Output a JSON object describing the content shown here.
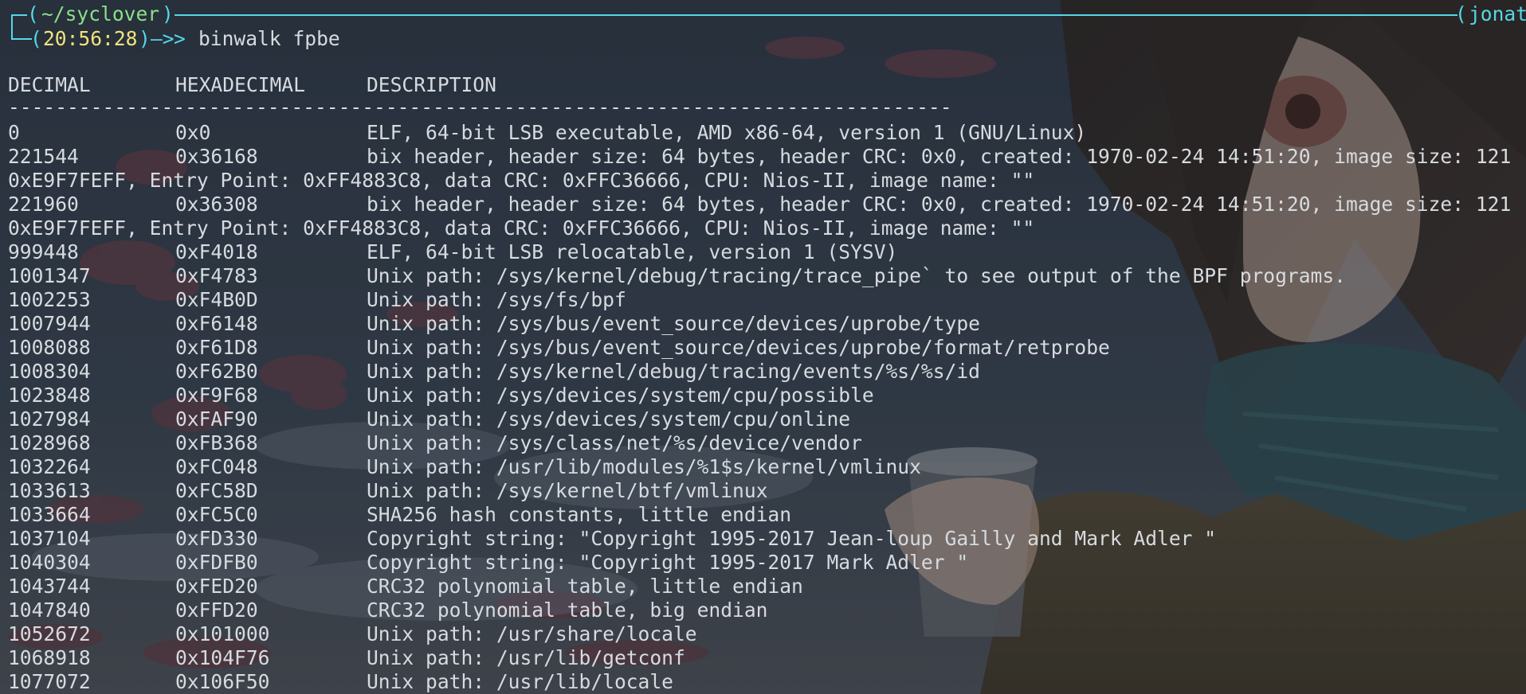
{
  "prompt": {
    "dir": "~/syclover",
    "time": "20:56:28",
    "arrow": "—>",
    "command": "binwalk fpbe",
    "user_fragment": "jonat",
    "open_paren": "(",
    "close_paren": ")"
  },
  "table": {
    "headers": [
      "DECIMAL",
      "HEXADECIMAL",
      "DESCRIPTION"
    ],
    "separator": "--------------------------------------------------------------------------------",
    "rows": [
      {
        "dec": "0",
        "hex": "0x0",
        "desc": "ELF, 64-bit LSB executable, AMD x86-64, version 1 (GNU/Linux)"
      },
      {
        "dec": "221544",
        "hex": "0x36168",
        "desc": "bix header, header size: 64 bytes, header CRC: 0x0, created: 1970-02-24 14:51:20, image size: 121"
      },
      {
        "dec": "",
        "hex": "",
        "desc": "",
        "wrap": "0xE9F7FEFF, Entry Point: 0xFF4883C8, data CRC: 0xFFC36666, CPU: Nios-II, image name: \"\""
      },
      {
        "dec": "221960",
        "hex": "0x36308",
        "desc": "bix header, header size: 64 bytes, header CRC: 0x0, created: 1970-02-24 14:51:20, image size: 121"
      },
      {
        "dec": "",
        "hex": "",
        "desc": "",
        "wrap": "0xE9F7FEFF, Entry Point: 0xFF4883C8, data CRC: 0xFFC36666, CPU: Nios-II, image name: \"\""
      },
      {
        "dec": "999448",
        "hex": "0xF4018",
        "desc": "ELF, 64-bit LSB relocatable, version 1 (SYSV)"
      },
      {
        "dec": "1001347",
        "hex": "0xF4783",
        "desc": "Unix path: /sys/kernel/debug/tracing/trace_pipe` to see output of the BPF programs."
      },
      {
        "dec": "1002253",
        "hex": "0xF4B0D",
        "desc": "Unix path: /sys/fs/bpf"
      },
      {
        "dec": "1007944",
        "hex": "0xF6148",
        "desc": "Unix path: /sys/bus/event_source/devices/uprobe/type"
      },
      {
        "dec": "1008088",
        "hex": "0xF61D8",
        "desc": "Unix path: /sys/bus/event_source/devices/uprobe/format/retprobe"
      },
      {
        "dec": "1008304",
        "hex": "0xF62B0",
        "desc": "Unix path: /sys/kernel/debug/tracing/events/%s/%s/id"
      },
      {
        "dec": "1023848",
        "hex": "0xF9F68",
        "desc": "Unix path: /sys/devices/system/cpu/possible"
      },
      {
        "dec": "1027984",
        "hex": "0xFAF90",
        "desc": "Unix path: /sys/devices/system/cpu/online"
      },
      {
        "dec": "1028968",
        "hex": "0xFB368",
        "desc": "Unix path: /sys/class/net/%s/device/vendor"
      },
      {
        "dec": "1032264",
        "hex": "0xFC048",
        "desc": "Unix path: /usr/lib/modules/%1$s/kernel/vmlinux"
      },
      {
        "dec": "1033613",
        "hex": "0xFC58D",
        "desc": "Unix path: /sys/kernel/btf/vmlinux"
      },
      {
        "dec": "1033664",
        "hex": "0xFC5C0",
        "desc": "SHA256 hash constants, little endian"
      },
      {
        "dec": "1037104",
        "hex": "0xFD330",
        "desc": "Copyright string: \"Copyright 1995-2017 Jean-loup Gailly and Mark Adler \""
      },
      {
        "dec": "1040304",
        "hex": "0xFDFB0",
        "desc": "Copyright string: \"Copyright 1995-2017 Mark Adler \""
      },
      {
        "dec": "1043744",
        "hex": "0xFED20",
        "desc": "CRC32 polynomial table, little endian"
      },
      {
        "dec": "1047840",
        "hex": "0xFFD20",
        "desc": "CRC32 polynomial table, big endian"
      },
      {
        "dec": "1052672",
        "hex": "0x101000",
        "desc": "Unix path: /usr/share/locale"
      },
      {
        "dec": "1068918",
        "hex": "0x104F76",
        "desc": "Unix path: /usr/lib/getconf"
      },
      {
        "dec": "1077072",
        "hex": "0x106F50",
        "desc": "Unix path: /usr/lib/locale"
      }
    ]
  },
  "colors": {
    "accent": "#55d7e6",
    "dir": "#8be08b",
    "time": "#f2e27a",
    "text": "#d7dbe0",
    "background": "#2a3340"
  }
}
